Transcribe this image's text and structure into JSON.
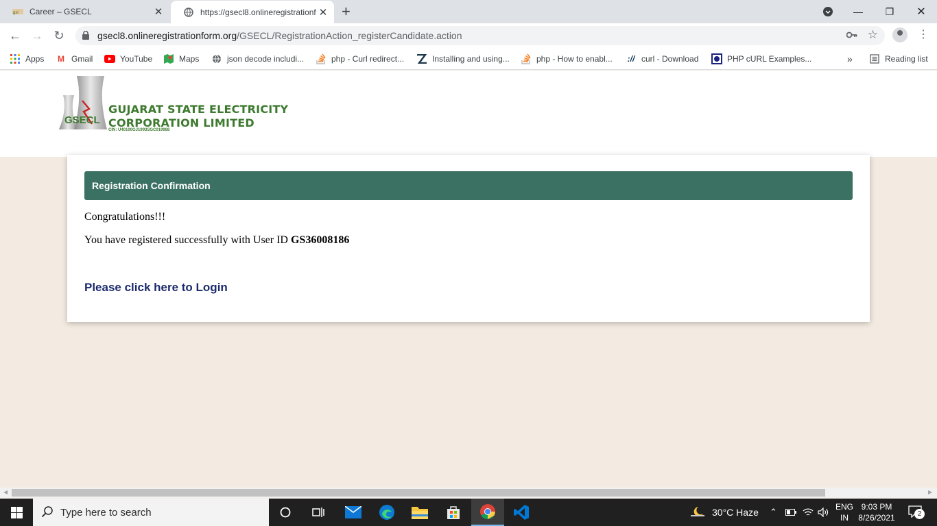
{
  "browser": {
    "tabs": [
      {
        "title": "Career – GSECL"
      },
      {
        "title": "https://gsecl8.onlineregistrationf…"
      }
    ],
    "url_host": "gsecl8.onlineregistrationform.org",
    "url_path": "/GSECL/RegistrationAction_registerCandidate.action",
    "bookmarks": [
      {
        "label": "Apps",
        "icon": "apps-grid-icon"
      },
      {
        "label": "Gmail",
        "icon": "gmail-icon"
      },
      {
        "label": "YouTube",
        "icon": "youtube-icon"
      },
      {
        "label": "Maps",
        "icon": "maps-icon"
      },
      {
        "label": "json decode includi...",
        "icon": "globe-icon"
      },
      {
        "label": "php - Curl redirect...",
        "icon": "stackoverflow-icon"
      },
      {
        "label": "Installing and using...",
        "icon": "zend-icon"
      },
      {
        "label": "php - How to enabl...",
        "icon": "stackoverflow-icon"
      },
      {
        "label": "curl - Download",
        "icon": "curl-icon"
      },
      {
        "label": "PHP cURL Examples...",
        "icon": "php-icon"
      }
    ],
    "more_bookmarks": "»",
    "reading_list": "Reading list"
  },
  "header": {
    "logo_abbr": "GSECL",
    "logo_line1": "GUJARAT STATE ELECTRICITY",
    "logo_line2": "CORPORATION LIMITED",
    "logo_cin": "CIN: U40100GJ1993SGC019988"
  },
  "confirmation": {
    "title": "Registration Confirmation",
    "congrats": "Congratulations!!!",
    "message_prefix": "You have registered successfully with User ID ",
    "user_id": "GS36008186",
    "login_link": "Please click here to Login"
  },
  "taskbar": {
    "search_placeholder": "Type here to search",
    "weather": "30°C  Haze",
    "lang_line1": "ENG",
    "lang_line2": "IN",
    "time": "9:03 PM",
    "date": "8/26/2021",
    "notifications": "2"
  },
  "colors": {
    "card_header": "#3b7163",
    "page_bg": "#f3ebe1",
    "link": "#1b2a6b",
    "brand_green": "#3d7a2f"
  }
}
